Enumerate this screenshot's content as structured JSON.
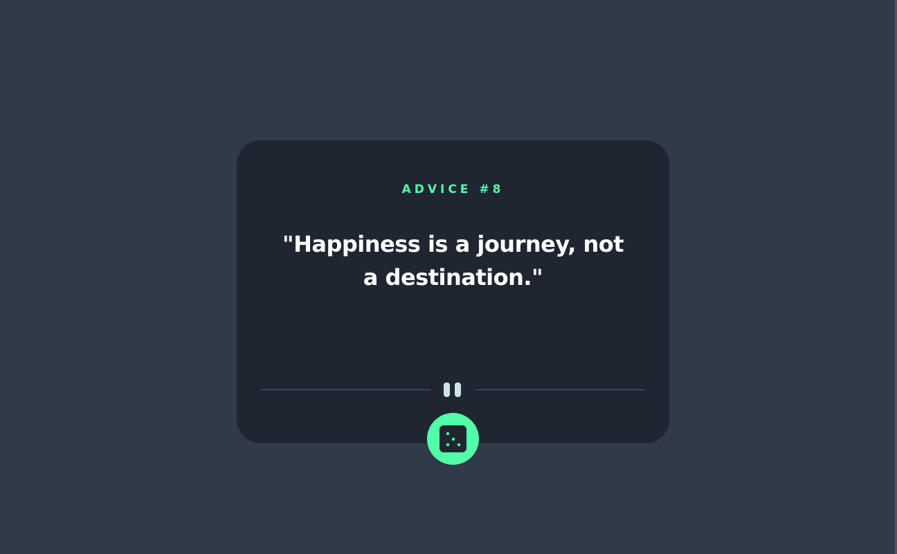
{
  "advice": {
    "id_label": "ADVICE #8",
    "quote": "\"Happiness is a journey, not a destination.\""
  },
  "divider": {
    "icon": "pause-icon"
  },
  "generate_button": {
    "icon": "dice-icon"
  },
  "colors": {
    "background": "#313a48",
    "card": "#1f2632",
    "accent": "#52ffa8",
    "text": "#ffffff",
    "divider_line": "#4f5d74",
    "pause_icon": "#cee3e9"
  }
}
